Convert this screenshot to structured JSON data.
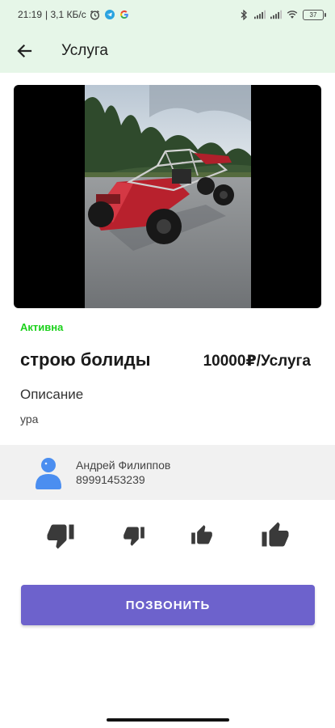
{
  "statusbar": {
    "time": "21:19",
    "speed": "| 3,1 КБ/с",
    "battery": "37"
  },
  "appbar": {
    "title": "Услуга",
    "back_icon": "arrow-back-icon"
  },
  "service": {
    "status": "Активна",
    "status_color": "#1bd11b",
    "name": "строю болиды",
    "price": "10000₽/Услуга",
    "description_label": "Описание",
    "description": "ура"
  },
  "owner": {
    "name": "Андрей Филиппов",
    "phone": "89991453239",
    "avatar_icon": "person-icon"
  },
  "ratings": [
    {
      "icon": "thumb-down-large-icon"
    },
    {
      "icon": "thumb-down-small-icon"
    },
    {
      "icon": "thumb-up-small-icon"
    },
    {
      "icon": "thumb-up-large-icon"
    }
  ],
  "actions": {
    "call_label": "ПОЗВОНИТЬ",
    "call_color": "#6d62cc"
  },
  "colors": {
    "appbar_bg": "#e6f6e8",
    "card_bg": "#f1f1f1"
  }
}
